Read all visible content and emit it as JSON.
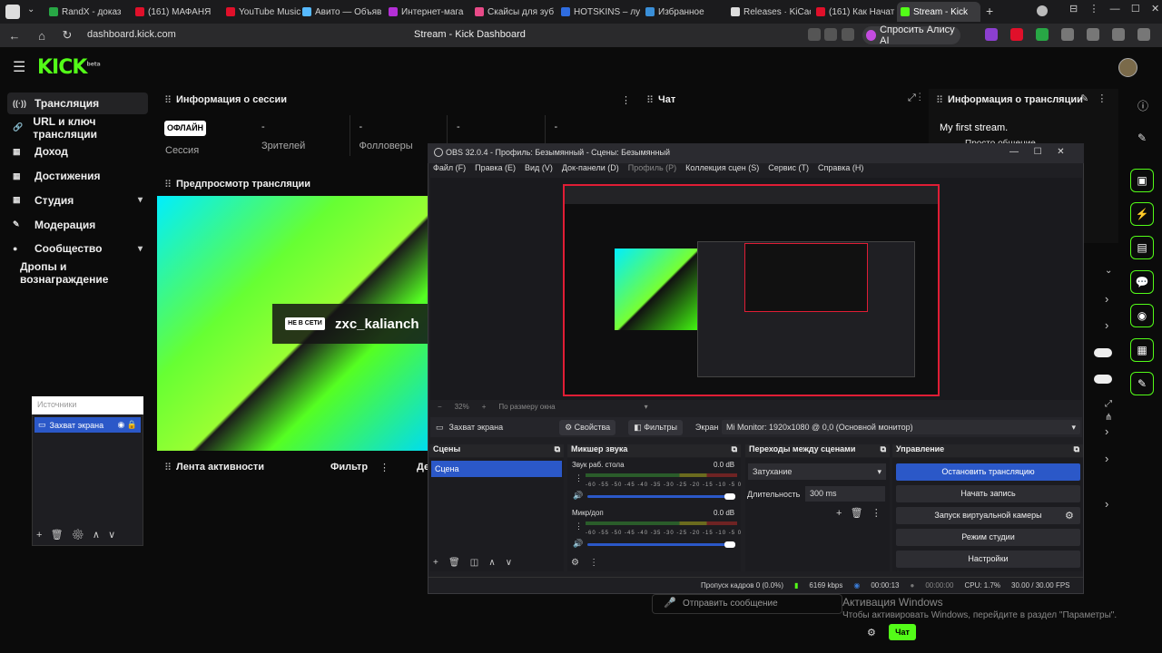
{
  "browser": {
    "tabs": [
      {
        "label": "RandX - доказ",
        "color": "#28a745"
      },
      {
        "label": "(161) МАФАНЯ",
        "color": "#e0102a"
      },
      {
        "label": "YouTube Music",
        "color": "#e0102a"
      },
      {
        "label": "Авито — Объяв",
        "color": "#56b9ff"
      },
      {
        "label": "Интернет-мага",
        "color": "#b42fd6"
      },
      {
        "label": "Скайсы для зуб",
        "color": "#e84a88"
      },
      {
        "label": "HOTSKINS – лу",
        "color": "#2f6de0"
      },
      {
        "label": "Избранное",
        "color": "#3a8fd8"
      },
      {
        "label": "Releases · KiCac",
        "color": "#dddddd"
      },
      {
        "label": "(161) Как Начат",
        "color": "#e0102a"
      },
      {
        "label": "Stream - Kick",
        "color": "#53fc18"
      }
    ],
    "url": "dashboard.kick.com",
    "page_title": "Stream - Kick Dashboard",
    "alisa": "Спросить Алису AI"
  },
  "kick": {
    "logo": "KICK",
    "logo_sup": "beta",
    "sidebar": [
      {
        "label": "Трансляция",
        "icon": "broadcast-icon",
        "glyph": "((·))",
        "active": true,
        "chev": false
      },
      {
        "label": "URL и ключ трансляции",
        "icon": "key-icon",
        "glyph": "🔗",
        "active": false,
        "chev": false
      },
      {
        "label": "Доход",
        "icon": "money-icon",
        "glyph": "▦",
        "active": false,
        "chev": false
      },
      {
        "label": "Достижения",
        "icon": "trophy-icon",
        "glyph": "▦",
        "active": false,
        "chev": false
      },
      {
        "label": "Студия",
        "icon": "studio-icon",
        "glyph": "▦",
        "active": false,
        "chev": true
      },
      {
        "label": "Модерация",
        "icon": "wrench-icon",
        "glyph": "✎",
        "active": false,
        "chev": false
      },
      {
        "label": "Сообщество",
        "icon": "community-icon",
        "glyph": "●",
        "active": false,
        "chev": true
      },
      {
        "label": "Дропы и вознаграждение",
        "icon": "",
        "glyph": "",
        "active": false,
        "chev": false
      }
    ],
    "session": {
      "title": "Информация о сессии",
      "status": "ОФЛАЙН",
      "session_label": "Сессия",
      "stats": [
        {
          "value": "-",
          "label": "Зрителей"
        },
        {
          "value": "-",
          "label": "Фолловеры"
        },
        {
          "value": "-",
          "label": ""
        },
        {
          "value": "-",
          "label": ""
        }
      ]
    },
    "chat_title": "Чат",
    "stream_info": {
      "title": "Информация о трансляции",
      "stream_title": "My first stream.",
      "category": "Просто общение"
    },
    "preview": {
      "title": "Предпросмотр трансляции",
      "live_badge": "НЕ В СЕТИ",
      "streamer": "zxc_kalianch"
    },
    "activity": {
      "title": "Лента активности",
      "filter": "Фильтр",
      "other": "Де"
    },
    "send_message": "Отправить сообщение",
    "chat_button": "Чат",
    "windows_activation": "Активация Windows",
    "windows_activation_sub": "Чтобы активировать Windows, перейдите в раздел \"Параметры\"."
  },
  "sources_float": {
    "header": "Источники",
    "item": "Захват экрана"
  },
  "obs": {
    "title": "OBS 32.0.4 - Профиль: Безымянный - Сцены: Безымянный",
    "menu": [
      {
        "label": "Файл (F)",
        "disabled": false
      },
      {
        "label": "Правка (E)",
        "disabled": false
      },
      {
        "label": "Вид (V)",
        "disabled": false
      },
      {
        "label": "Док-панели (D)",
        "disabled": false
      },
      {
        "label": "Профиль (P)",
        "disabled": true
      },
      {
        "label": "Коллекция сцен (S)",
        "disabled": false
      },
      {
        "label": "Сервис (T)",
        "disabled": false
      },
      {
        "label": "Справка (H)",
        "disabled": false
      }
    ],
    "zoom": "32%",
    "zoom_mode": "По размеру окна",
    "source_name": "Захват экрана",
    "properties": "Свойства",
    "filters": "Фильтры",
    "screen_label": "Экран",
    "monitor": "Mi Monitor: 1920x1080 @ 0,0 (Основной монитор)",
    "docks": {
      "scenes": "Сцены",
      "mixer": "Микшер звука",
      "transitions": "Переходы между сценами",
      "controls": "Управление"
    },
    "scene": "Сцена",
    "mixer": [
      {
        "name": "Звук раб. стола",
        "db": "0.0 dB"
      },
      {
        "name": "Микр/доп",
        "db": "0.0 dB"
      }
    ],
    "meter_scale": "-60 -55 -50 -45 -40 -35 -30 -25 -20 -15 -10 -5 0",
    "transition": "Затухание",
    "duration_label": "Длительность",
    "duration": "300 ms",
    "controls": [
      {
        "label": "Остановить трансляцию",
        "primary": true
      },
      {
        "label": "Начать запись",
        "primary": false
      },
      {
        "label": "Запуск виртуальной камеры",
        "primary": false
      },
      {
        "label": "Режим студии",
        "primary": false
      },
      {
        "label": "Настройки",
        "primary": false
      }
    ],
    "status": {
      "dropped": "Пропуск кадров 0 (0.0%)",
      "bitrate": "6169 kbps",
      "stream_time": "00:00:13",
      "rec_time": "00:00:00",
      "cpu": "CPU: 1.7%",
      "fps": "30.00 / 30.00 FPS"
    }
  }
}
